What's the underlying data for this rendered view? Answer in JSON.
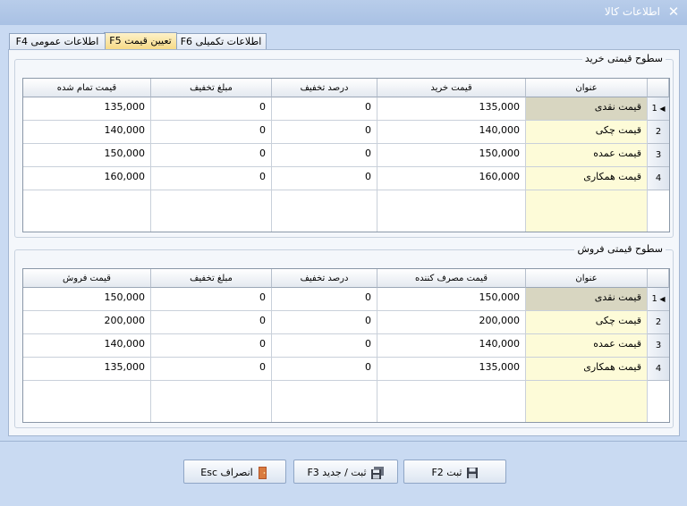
{
  "window": {
    "title": "اطلاعات کالا"
  },
  "tabs": [
    {
      "label": "اطلاعات تکمیلی F6"
    },
    {
      "label": "تعیین قیمت F5"
    },
    {
      "label": "اطلاعات عمومی F4"
    }
  ],
  "purchase": {
    "title": "سطوح قیمتی خرید",
    "headers": [
      "عنوان",
      "قیمت خرید",
      "درصد تخفیف",
      "مبلغ تخفیف",
      "قیمت تمام شده"
    ],
    "rows": [
      {
        "num": "1",
        "name": "قیمت نقدی",
        "price": "135,000",
        "discount_pct": "0",
        "discount_amt": "0",
        "final": "135,000"
      },
      {
        "num": "2",
        "name": "قیمت چکی",
        "price": "140,000",
        "discount_pct": "0",
        "discount_amt": "0",
        "final": "140,000"
      },
      {
        "num": "3",
        "name": "قیمت عمده",
        "price": "150,000",
        "discount_pct": "0",
        "discount_amt": "0",
        "final": "150,000"
      },
      {
        "num": "4",
        "name": "قیمت همکاری",
        "price": "160,000",
        "discount_pct": "0",
        "discount_amt": "0",
        "final": "160,000"
      }
    ]
  },
  "sales": {
    "title": "سطوح قیمتی فروش",
    "headers": [
      "عنوان",
      "قیمت مصرف کننده",
      "درصد تخفیف",
      "مبلغ تخفیف",
      "قیمت فروش"
    ],
    "rows": [
      {
        "num": "1",
        "name": "قیمت نقدی",
        "price": "150,000",
        "discount_pct": "0",
        "discount_amt": "0",
        "final": "150,000"
      },
      {
        "num": "2",
        "name": "قیمت چکی",
        "price": "200,000",
        "discount_pct": "0",
        "discount_amt": "0",
        "final": "200,000"
      },
      {
        "num": "3",
        "name": "قیمت عمده",
        "price": "140,000",
        "discount_pct": "0",
        "discount_amt": "0",
        "final": "140,000"
      },
      {
        "num": "4",
        "name": "قیمت همکاری",
        "price": "135,000",
        "discount_pct": "0",
        "discount_amt": "0",
        "final": "135,000"
      }
    ]
  },
  "buttons": {
    "save": "ثبت F2",
    "save_new": "ثبت / جدید F3",
    "cancel": "انصراف Esc"
  }
}
